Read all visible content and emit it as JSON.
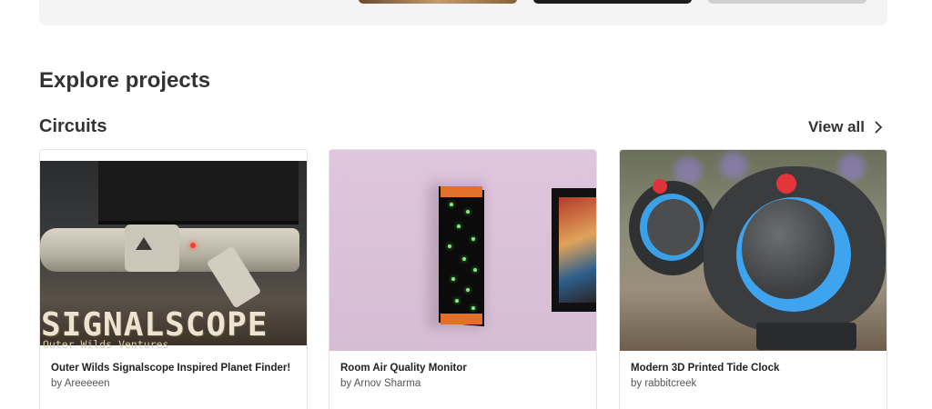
{
  "section": {
    "title": "Explore projects"
  },
  "category": {
    "title": "Circuits",
    "view_all_label": "View all"
  },
  "cards": [
    {
      "title": "Outer Wilds Signalscope Inspired Planet Finder!",
      "author": "by Areeeeen",
      "image_text": {
        "headline": "SIGNALSCOPE",
        "subline": "Outer Wilds Ventures"
      }
    },
    {
      "title": "Room Air Quality Monitor",
      "author": "by Arnov Sharma"
    },
    {
      "title": "Modern 3D Printed Tide Clock",
      "author": "by rabbitcreek"
    }
  ]
}
